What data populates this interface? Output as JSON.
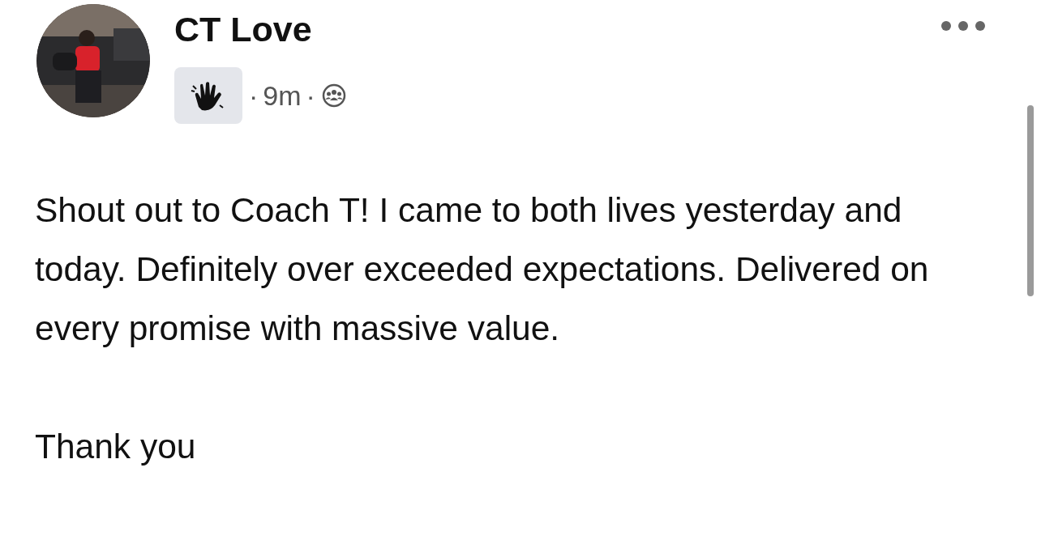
{
  "post": {
    "author": "CT Love",
    "avatar": {
      "kind": "picture"
    },
    "meta": [
      {
        "kind": "text",
        "text": "·"
      },
      {
        "kind": "text",
        "text": "9m"
      },
      {
        "kind": "text",
        "text": "·"
      }
    ],
    "paragraphs": [
      "Shout out to Coach T! I came to both lives yesterday and today. Definitely over exceeded expectations. Delivered on every promise with massive value.",
      "Thank you"
    ]
  }
}
